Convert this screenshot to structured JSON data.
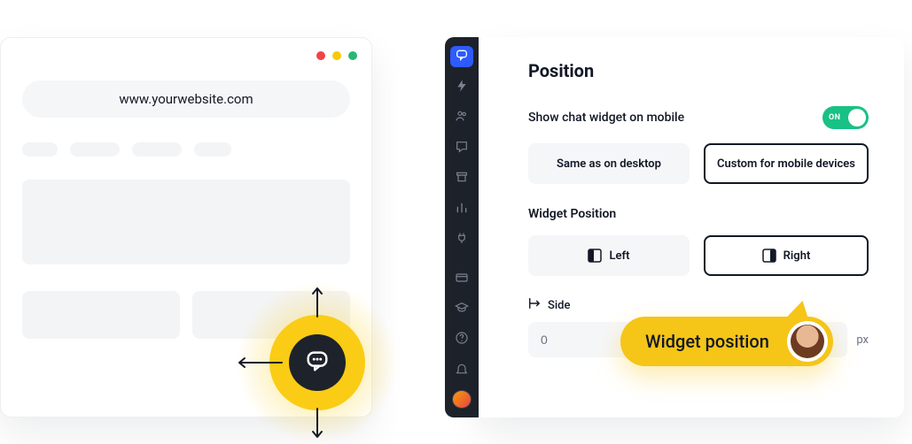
{
  "browser": {
    "url": "www.yourwebsite.com"
  },
  "panel": {
    "title": "Position",
    "show_mobile_label": "Show chat widget on mobile",
    "toggle_on_label": "ON",
    "layout_options": {
      "desktop": "Same as on desktop",
      "custom": "Custom for mobile devices"
    },
    "widget_position_label": "Widget Position",
    "position_options": {
      "left": "Left",
      "right": "Right"
    },
    "side": {
      "label": "Side",
      "value": "0",
      "unit": "px"
    }
  },
  "tooltip": {
    "text": "Widget position"
  }
}
